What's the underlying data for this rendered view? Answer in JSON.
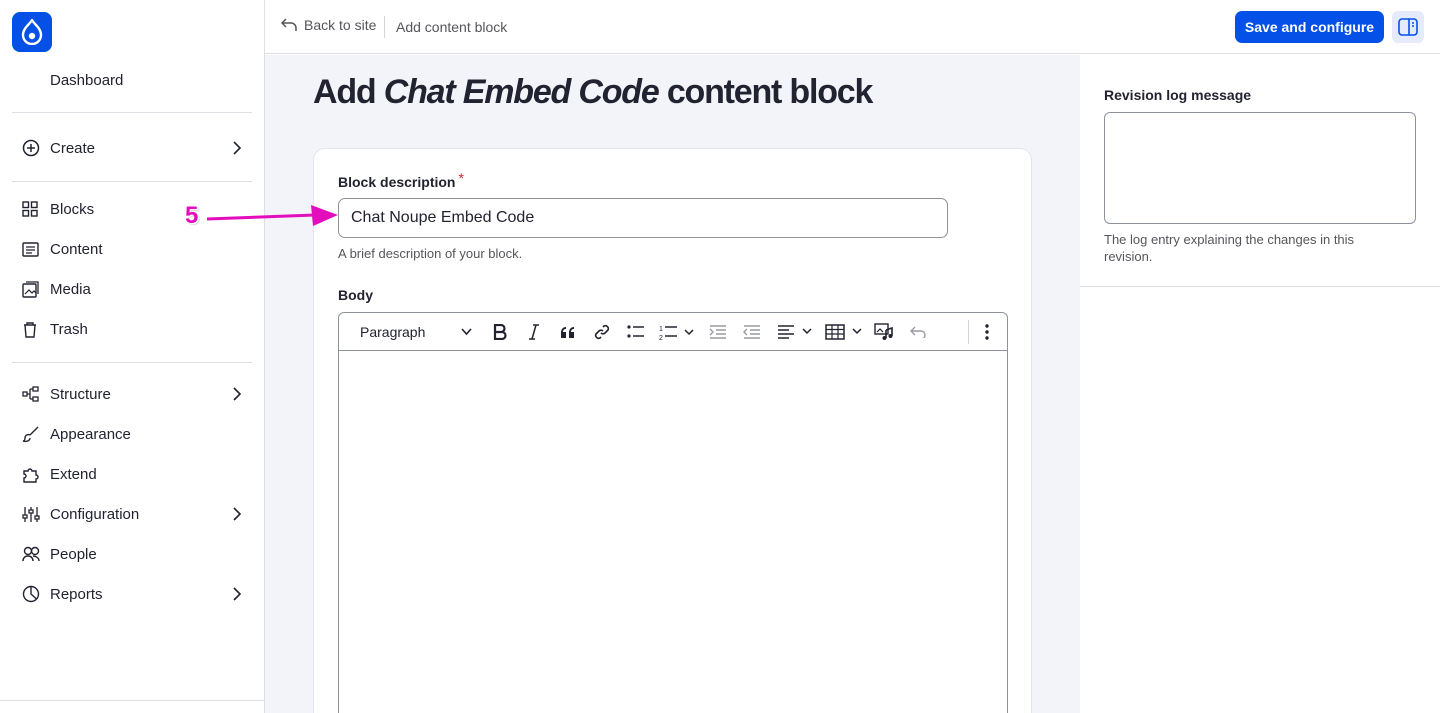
{
  "sidebar": {
    "dashboard_label": "Dashboard",
    "items": [
      {
        "label": "Create",
        "icon": "plus-circle-icon",
        "has_submenu": true
      },
      {
        "label": "Blocks",
        "icon": "blocks-grid-icon",
        "has_submenu": false
      },
      {
        "label": "Content",
        "icon": "content-list-icon",
        "has_submenu": false
      },
      {
        "label": "Media",
        "icon": "media-image-icon",
        "has_submenu": false
      },
      {
        "label": "Trash",
        "icon": "trash-icon",
        "has_submenu": false
      },
      {
        "label": "Structure",
        "icon": "structure-icon",
        "has_submenu": true
      },
      {
        "label": "Appearance",
        "icon": "brush-icon",
        "has_submenu": false
      },
      {
        "label": "Extend",
        "icon": "puzzle-icon",
        "has_submenu": false
      },
      {
        "label": "Configuration",
        "icon": "sliders-icon",
        "has_submenu": true
      },
      {
        "label": "People",
        "icon": "people-icon",
        "has_submenu": false
      },
      {
        "label": "Reports",
        "icon": "chart-pie-icon",
        "has_submenu": true
      }
    ]
  },
  "topbar": {
    "back_label": "Back to site",
    "breadcrumb": "Add content block",
    "save_label": "Save and configure"
  },
  "main": {
    "title_prefix": "Add",
    "title_type": "Chat Embed Code",
    "title_suffix": "content block",
    "block_description_label": "Block description",
    "required_mark": "*",
    "block_description_value": "Chat Noupe Embed Code",
    "block_description_help": "A brief description of your block.",
    "body_label": "Body",
    "editor": {
      "format_selected": "Paragraph"
    }
  },
  "side": {
    "revision_label": "Revision log message",
    "revision_value": "",
    "revision_help": "The log entry explaining the changes in this revision."
  },
  "annotation": {
    "step_number": "5",
    "color": "#e40dbe"
  },
  "colors": {
    "accent": "#0550e6",
    "page_bg": "#f3f4f9",
    "required": "#d72222"
  }
}
